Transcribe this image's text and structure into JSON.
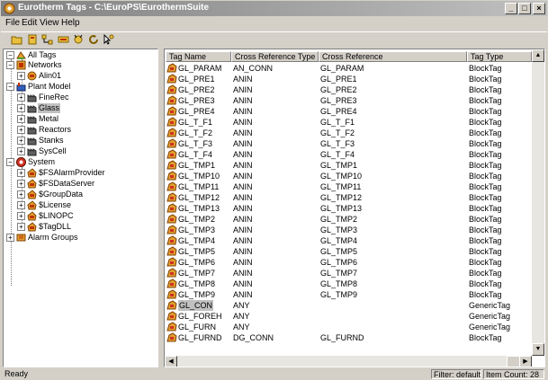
{
  "window": {
    "title": "Eurotherm Tags - C:\\EuroPS\\EurothermSuite",
    "minimize": "_",
    "maximize": "□",
    "close": "×"
  },
  "menu": [
    "File",
    "Edit",
    "View",
    "Help"
  ],
  "toolbar": [
    "open-folder-icon",
    "tag-icon",
    "network-icon",
    "filter-icon",
    "properties-icon",
    "refresh-icon",
    "help-pointer-icon"
  ],
  "tree": {
    "all_tags": "All Tags",
    "networks": "Networks",
    "alin": "Alin01",
    "plant_model": "Plant Model",
    "finerec": "FineRec",
    "glass": "Glass",
    "metal": "Metal",
    "reactors": "Reactors",
    "stanks": "Stanks",
    "syscell": "SysCell",
    "system": "System",
    "fsalarm": "$FSAlarmProvider",
    "fsdata": "$FSDataServer",
    "groupdata": "$GroupData",
    "license": "$License",
    "linopc": "$LINOPC",
    "tagdll": "$TagDLL",
    "alarm_groups": "Alarm Groups"
  },
  "table": {
    "columns": [
      "Tag Name",
      "Cross Reference Type",
      "Cross Reference",
      "",
      "Tag Type"
    ],
    "rows": [
      [
        "GL_PARAM",
        "AN_CONN",
        "GL_PARAM",
        "BlockTag"
      ],
      [
        "GL_PRE1",
        "ANIN",
        "GL_PRE1",
        "BlockTag"
      ],
      [
        "GL_PRE2",
        "ANIN",
        "GL_PRE2",
        "BlockTag"
      ],
      [
        "GL_PRE3",
        "ANIN",
        "GL_PRE3",
        "BlockTag"
      ],
      [
        "GL_PRE4",
        "ANIN",
        "GL_PRE4",
        "BlockTag"
      ],
      [
        "GL_T_F1",
        "ANIN",
        "GL_T_F1",
        "BlockTag"
      ],
      [
        "GL_T_F2",
        "ANIN",
        "GL_T_F2",
        "BlockTag"
      ],
      [
        "GL_T_F3",
        "ANIN",
        "GL_T_F3",
        "BlockTag"
      ],
      [
        "GL_T_F4",
        "ANIN",
        "GL_T_F4",
        "BlockTag"
      ],
      [
        "GL_TMP1",
        "ANIN",
        "GL_TMP1",
        "BlockTag"
      ],
      [
        "GL_TMP10",
        "ANIN",
        "GL_TMP10",
        "BlockTag"
      ],
      [
        "GL_TMP11",
        "ANIN",
        "GL_TMP11",
        "BlockTag"
      ],
      [
        "GL_TMP12",
        "ANIN",
        "GL_TMP12",
        "BlockTag"
      ],
      [
        "GL_TMP13",
        "ANIN",
        "GL_TMP13",
        "BlockTag"
      ],
      [
        "GL_TMP2",
        "ANIN",
        "GL_TMP2",
        "BlockTag"
      ],
      [
        "GL_TMP3",
        "ANIN",
        "GL_TMP3",
        "BlockTag"
      ],
      [
        "GL_TMP4",
        "ANIN",
        "GL_TMP4",
        "BlockTag"
      ],
      [
        "GL_TMP5",
        "ANIN",
        "GL_TMP5",
        "BlockTag"
      ],
      [
        "GL_TMP6",
        "ANIN",
        "GL_TMP6",
        "BlockTag"
      ],
      [
        "GL_TMP7",
        "ANIN",
        "GL_TMP7",
        "BlockTag"
      ],
      [
        "GL_TMP8",
        "ANIN",
        "GL_TMP8",
        "BlockTag"
      ],
      [
        "GL_TMP9",
        "ANIN",
        "GL_TMP9",
        "BlockTag"
      ],
      [
        "GL_CON",
        "ANY",
        "",
        "GenericTag"
      ],
      [
        "GL_FOREH",
        "ANY",
        "",
        "GenericTag"
      ],
      [
        "GL_FURN",
        "ANY",
        "",
        "GenericTag"
      ],
      [
        "GL_FURND",
        "DG_CONN",
        "GL_FURND",
        "BlockTag"
      ]
    ],
    "selected_index": 22
  },
  "scroll": {
    "up": "▲",
    "down": "▼",
    "left": "◀",
    "right": "▶"
  },
  "status": {
    "ready": "Ready",
    "filter": "Filter: default",
    "count": "Item Count: 28"
  },
  "colors": {
    "chrome": "#d4d0c8",
    "title_gradient_start": "#808080",
    "title_gradient_end": "#c0c0c0",
    "selection": "#c0c0c0"
  }
}
